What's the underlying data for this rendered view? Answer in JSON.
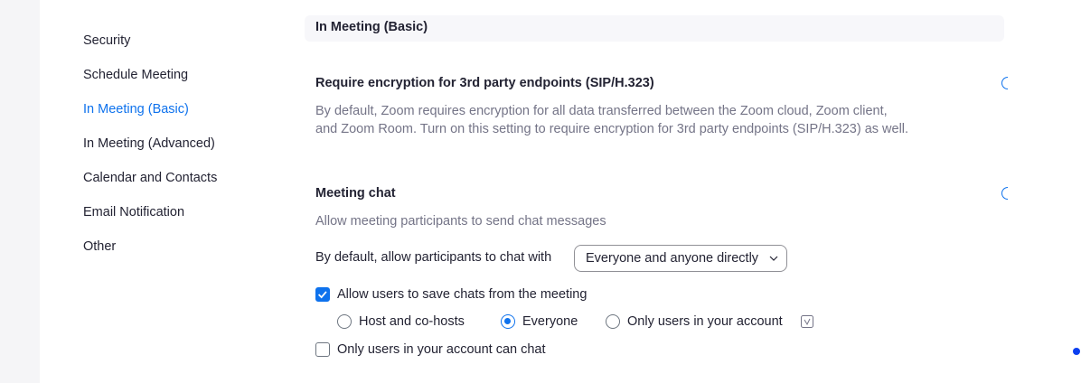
{
  "sidebar": {
    "items": [
      {
        "label": "Security"
      },
      {
        "label": "Schedule Meeting"
      },
      {
        "label": "In Meeting (Basic)",
        "active": true
      },
      {
        "label": "In Meeting (Advanced)"
      },
      {
        "label": "Calendar and Contacts"
      },
      {
        "label": "Email Notification"
      },
      {
        "label": "Other"
      }
    ]
  },
  "section": {
    "title": "In Meeting (Basic)"
  },
  "encryption": {
    "title": "Require encryption for 3rd party endpoints (SIP/H.323)",
    "desc_line1": "By default, Zoom requires encryption for all data transferred between the Zoom cloud, Zoom client,",
    "desc_line2": "and Zoom Room. Turn on this setting to require encryption for 3rd party endpoints (SIP/H.323) as well.",
    "enabled": true
  },
  "meeting_chat": {
    "title": "Meeting chat",
    "desc": "Allow meeting participants to send chat messages",
    "enabled": true,
    "default_label": "By default, allow participants to chat with",
    "default_value": "Everyone and anyone directly",
    "save_chats": {
      "label": "Allow users to save chats from the meeting",
      "checked": true
    },
    "save_options": [
      {
        "label": "Host and co-hosts",
        "selected": false
      },
      {
        "label": "Everyone",
        "selected": true
      },
      {
        "label": "Only users in your account",
        "selected": false
      }
    ],
    "account_only": {
      "label": "Only users in your account can chat",
      "checked": false
    }
  },
  "colors": {
    "accent": "#0e72ed",
    "text": "#232333",
    "muted": "#747487"
  },
  "icons": {
    "info": "info-icon",
    "dropdown": "chevron-down-icon",
    "check": "checkmark-icon"
  }
}
